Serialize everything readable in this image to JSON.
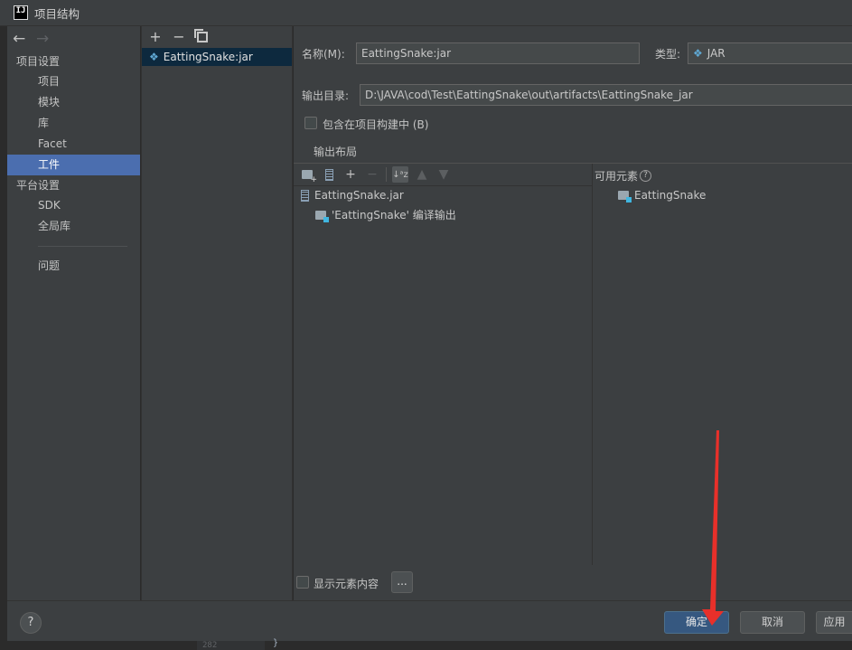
{
  "window": {
    "title": "项目结构",
    "app_icon_text": "IJ"
  },
  "nav": {
    "back": "←",
    "forward": "→",
    "sections": [
      {
        "title": "项目设置",
        "items": [
          "项目",
          "模块",
          "库",
          "Facet",
          "工件"
        ]
      },
      {
        "title": "平台设置",
        "items": [
          "SDK",
          "全局库"
        ]
      }
    ],
    "selected": "工件",
    "problems": "问题"
  },
  "artifacts": {
    "add": "+",
    "remove": "−",
    "items": [
      {
        "name": "EattingSnake:jar"
      }
    ]
  },
  "form": {
    "name_label": "名称(M):",
    "name_value": "EattingSnake:jar",
    "type_label": "类型:",
    "type_value": "JAR",
    "output_dir_label": "输出目录:",
    "output_dir_value": "D:\\JAVA\\cod\\Test\\EattingSnake\\out\\artifacts\\EattingSnake_jar",
    "include_in_build_label": "包含在项目构建中 (B)",
    "include_in_build_checked": false
  },
  "layout": {
    "title": "输出布局",
    "tree": [
      {
        "label": "EattingSnake.jar",
        "icon": "zip-icon",
        "level": 0
      },
      {
        "label": "'EattingSnake' 编译输出",
        "icon": "module-folder-icon",
        "level": 1
      }
    ],
    "available_title": "可用元素",
    "available_items": [
      {
        "label": "EattingSnake",
        "icon": "module-folder-icon"
      }
    ],
    "show_content_label": "显示元素内容",
    "show_content_checked": false,
    "dots_label": "..."
  },
  "footer": {
    "help": "?",
    "ok": "确定",
    "cancel": "取消",
    "apply": "应用"
  },
  "editor": {
    "line_number": "282",
    "brace": "}"
  },
  "colors": {
    "selection": "#4b6eaf",
    "primary_button": "#365880",
    "annotation_arrow": "#e8302a"
  }
}
